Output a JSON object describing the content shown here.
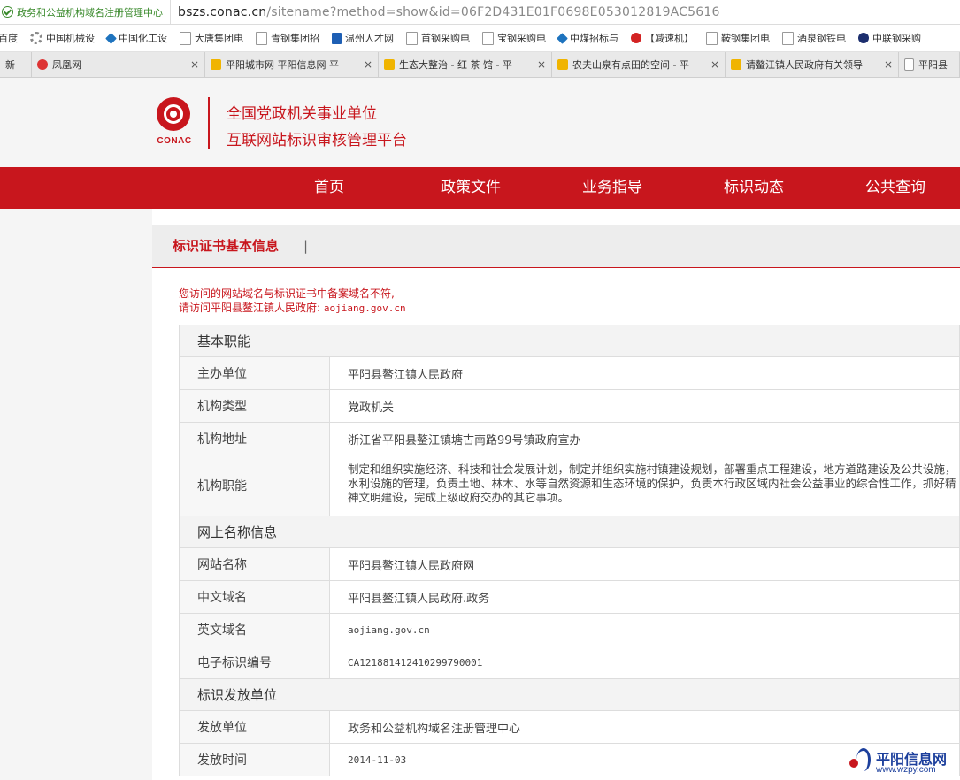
{
  "browser": {
    "security_label": "政务和公益机构域名注册管理中心",
    "url_host": "bszs.conac.cn",
    "url_path": "/sitename?method=show&id=06F2D431E01F0698E053012819AC5616"
  },
  "bookmarks": [
    "百度",
    "中国机械设",
    "中国化工设",
    "大唐集团电",
    "青钢集团招",
    "温州人才网",
    "首钢采购电",
    "宝钢采购电",
    "中煤招标与",
    "【减速机】",
    "鞍钢集团电",
    "酒泉钢铁电",
    "中联钢采购"
  ],
  "tabs": [
    {
      "label": "新",
      "close": ""
    },
    {
      "label": "凤凰网",
      "close": "×"
    },
    {
      "label": "平阳城市网 平阳信息网 平",
      "close": "×"
    },
    {
      "label": "生态大整治 - 红 茶 馆 - 平",
      "close": "×"
    },
    {
      "label": "农夫山泉有点田的空间 - 平",
      "close": "×"
    },
    {
      "label": "请鳌江镇人民政府有关领导",
      "close": "×"
    },
    {
      "label": "平阳县",
      "close": ""
    }
  ],
  "header": {
    "logo_text": "CONAC",
    "title_line1": "全国党政机关事业单位",
    "title_line2": "互联网站标识审核管理平台"
  },
  "nav": [
    "首页",
    "政策文件",
    "业务指导",
    "标识动态",
    "公共查询"
  ],
  "content": {
    "section_title": "标识证书基本信息",
    "separator": "|",
    "notice_line1": "您访问的网站域名与标识证书中备案域名不符,",
    "notice_line2_prefix": "请访问平阳县鳌江镇人民政府:",
    "notice_domain": "aojiang.gov.cn"
  },
  "table": {
    "basic": {
      "title": "基本职能",
      "rows": [
        {
          "k": "主办单位",
          "v": "平阳县鳌江镇人民政府"
        },
        {
          "k": "机构类型",
          "v": "党政机关"
        },
        {
          "k": "机构地址",
          "v": "浙江省平阳县鳌江镇塘古南路99号镇政府宣办"
        },
        {
          "k": "机构职能",
          "v": "制定和组织实施经济、科技和社会发展计划，制定并组织实施村镇建设规划，部署重点工程建设，地方道路建设及公共设施，水利设施的管理，负责土地、林木、水等自然资源和生态环境的保护，负责本行政区域内社会公益事业的综合性工作，抓好精神文明建设，完成上级政府交办的其它事项。"
        }
      ]
    },
    "online": {
      "title": "网上名称信息",
      "rows": [
        {
          "k": "网站名称",
          "v": "平阳县鳌江镇人民政府网"
        },
        {
          "k": "中文域名",
          "v": "平阳县鳌江镇人民政府.政务"
        },
        {
          "k": "英文域名",
          "v": "aojiang.gov.cn"
        },
        {
          "k": "电子标识编号",
          "v": "CA121881412410299790001"
        }
      ]
    },
    "issuer": {
      "title": "标识发放单位",
      "rows": [
        {
          "k": "发放单位",
          "v": "政务和公益机构域名注册管理中心"
        },
        {
          "k": "发放时间",
          "v": "2014-11-03"
        }
      ]
    }
  },
  "watermark": {
    "name": "平阳信息网",
    "url": "www.wzpy.com"
  }
}
